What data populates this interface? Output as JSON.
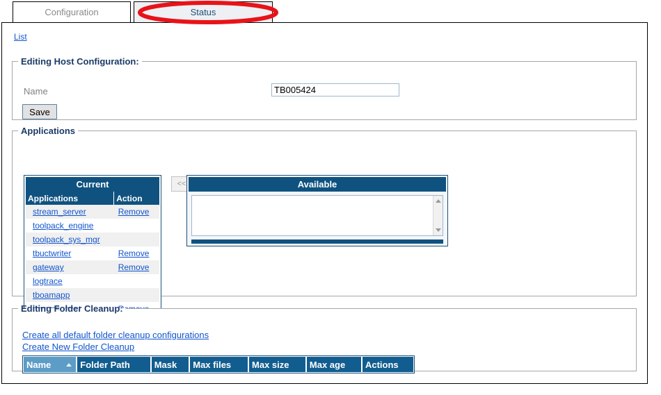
{
  "tabs": [
    {
      "label": "Configuration",
      "state": "inactive"
    },
    {
      "label": "Status",
      "state": "active"
    }
  ],
  "nav": {
    "list_link": "List"
  },
  "host_config": {
    "legend": "Editing Host Configuration:",
    "name_label": "Name",
    "name_value": "TB005424",
    "name_placeholder": "",
    "save_label": "Save"
  },
  "applications": {
    "legend": "Applications",
    "current": {
      "title": "Current",
      "columns": [
        "Applications",
        "Action"
      ],
      "rows": [
        {
          "name": "stream_server",
          "action": "Remove"
        },
        {
          "name": "toolpack_engine",
          "action": ""
        },
        {
          "name": "toolpack_sys_mgr",
          "action": ""
        },
        {
          "name": "tbuctwriter",
          "action": "Remove"
        },
        {
          "name": "gateway",
          "action": "Remove"
        },
        {
          "name": "logtrace",
          "action": ""
        },
        {
          "name": "tboamapp",
          "action": ""
        },
        {
          "name": "tbsnmpagent",
          "action": "Remove"
        }
      ]
    },
    "transfer_button": {
      "label": "<<",
      "enabled": false
    },
    "available": {
      "title": "Available",
      "options": []
    }
  },
  "folder_cleanup": {
    "legend": "Editing Folder Cleanup:",
    "links": [
      "Create all default folder cleanup configurations",
      "Create New Folder Cleanup"
    ],
    "columns": [
      {
        "label": "Name",
        "sorted": true,
        "sort_direction": "asc"
      },
      {
        "label": "Folder Path",
        "sorted": false
      },
      {
        "label": "Mask",
        "sorted": false
      },
      {
        "label": "Max files",
        "sorted": false
      },
      {
        "label": "Max size",
        "sorted": false
      },
      {
        "label": "Max age",
        "sorted": false
      },
      {
        "label": "Actions",
        "sorted": false
      }
    ],
    "rows": []
  },
  "annotation": {
    "shape": "ellipse",
    "color": "#e8131a",
    "target": "Status"
  },
  "colors": {
    "header_blue": "#0f5280",
    "table_header_blue": "#125d90",
    "sorted_header_blue": "#5c9cc6",
    "legend_navy": "#1b3a67",
    "link_blue": "#1155cc",
    "row_shade": "#f0f0f0",
    "annotation_red": "#e8131a"
  }
}
